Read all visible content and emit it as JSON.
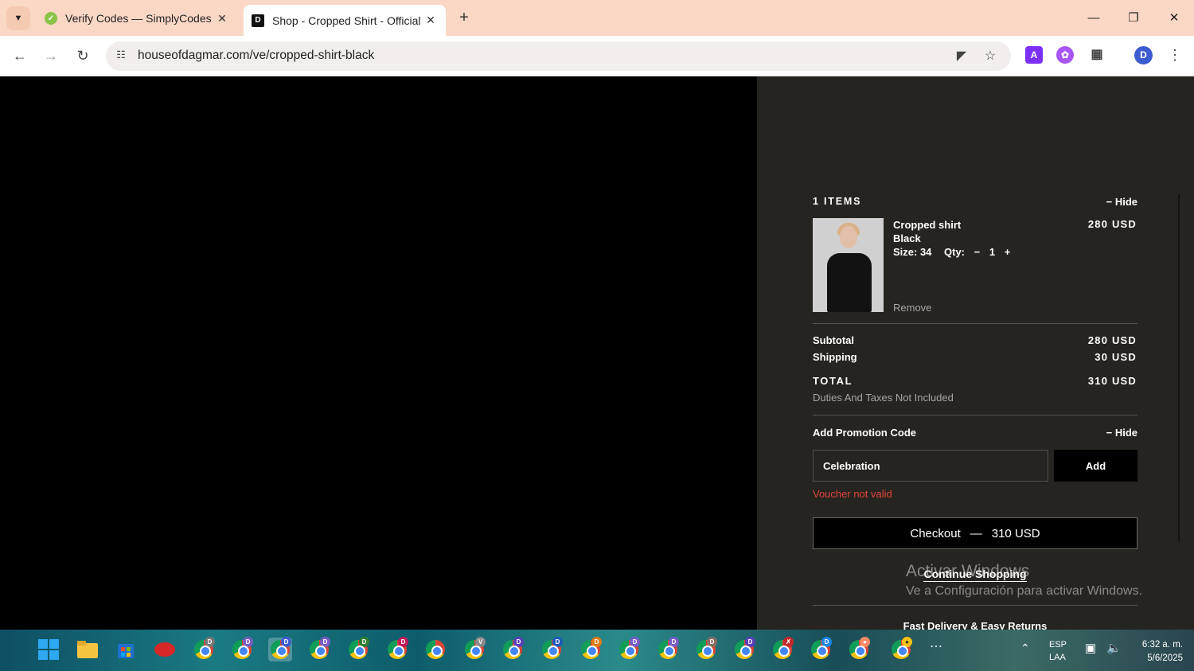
{
  "browser": {
    "tabs": [
      {
        "title": "Verify Codes — SimplyCodes",
        "favicon": "simplycodes-icon",
        "active": false
      },
      {
        "title": "Shop - Cropped Shirt - Official",
        "favicon": "dagmar-icon",
        "active": true
      }
    ],
    "favicon_letters": {
      "dagmar": "D"
    },
    "url": "houseofdagmar.com/ve/cropped-shirt-black",
    "profile_initial": "D",
    "extension_letter": "A"
  },
  "cart": {
    "items_heading": "1 ITEMS",
    "hide_label": "− Hide",
    "item": {
      "name": "Cropped shirt",
      "color": "Black",
      "price": "280 USD",
      "size_label": "Size: 34",
      "qty_label": "Qty:",
      "qty_minus": "−",
      "qty_value": "1",
      "qty_plus": "+",
      "remove": "Remove"
    },
    "subtotal_label": "Subtotal",
    "subtotal_value": "280 USD",
    "shipping_label": "Shipping",
    "shipping_value": "30 USD",
    "total_label": "TOTAL",
    "total_value": "310 USD",
    "duties_note": "Duties And Taxes Not Included",
    "promo": {
      "title": "Add Promotion Code",
      "hide_label": "− Hide",
      "input_value": "Celebration",
      "add_label": "Add",
      "error": "Voucher not valid"
    },
    "checkout_label": "Checkout",
    "checkout_dash": "—",
    "checkout_amount": "310 USD",
    "continue_label": "Continue Shopping",
    "footer_note": "Fast Delivery & Easy Returns"
  },
  "watermark": {
    "line1": "Activar Windows",
    "line2": "Ve a Configuración para activar Windows."
  },
  "taskbar": {
    "chrome_badges": [
      "D",
      "D",
      "D",
      "D",
      "D",
      "D",
      "",
      "V",
      "D",
      "D",
      "D",
      "D",
      "D",
      "D",
      "D",
      "",
      "D",
      "",
      ""
    ],
    "language": "ESP",
    "language_sub": "LAA",
    "time": "6:32 a. m.",
    "date": "5/6/2025"
  },
  "colors": {
    "cart_bg": "#262420",
    "error": "#e2453a",
    "tabstrip": "#fbd8c6"
  }
}
